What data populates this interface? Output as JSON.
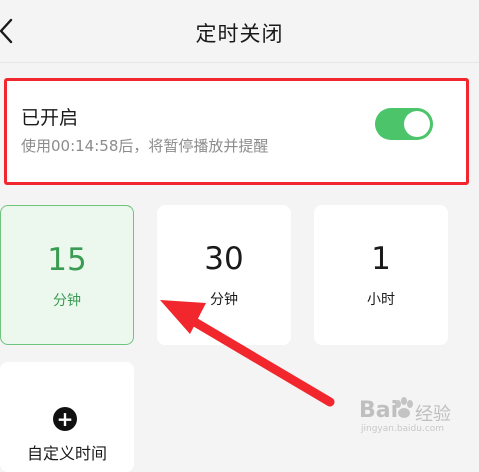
{
  "header": {
    "title": "定时关闭"
  },
  "timer": {
    "status": "已开启",
    "description": "使用00:14:58后，将暂停播放并提醒",
    "toggle_on": true
  },
  "options": [
    {
      "value": "15",
      "unit": "分钟",
      "selected": true
    },
    {
      "value": "30",
      "unit": "分钟",
      "selected": false
    },
    {
      "value": "1",
      "unit": "小时",
      "selected": false
    }
  ],
  "custom": {
    "label": "自定义时间"
  },
  "watermark": {
    "brand": "Bai",
    "product": "经验",
    "url": "jingyan.baidu.com"
  },
  "colors": {
    "accent_green": "#4cc56a",
    "highlight_red": "#f2262d",
    "selected_bg": "#ecf8ee"
  }
}
